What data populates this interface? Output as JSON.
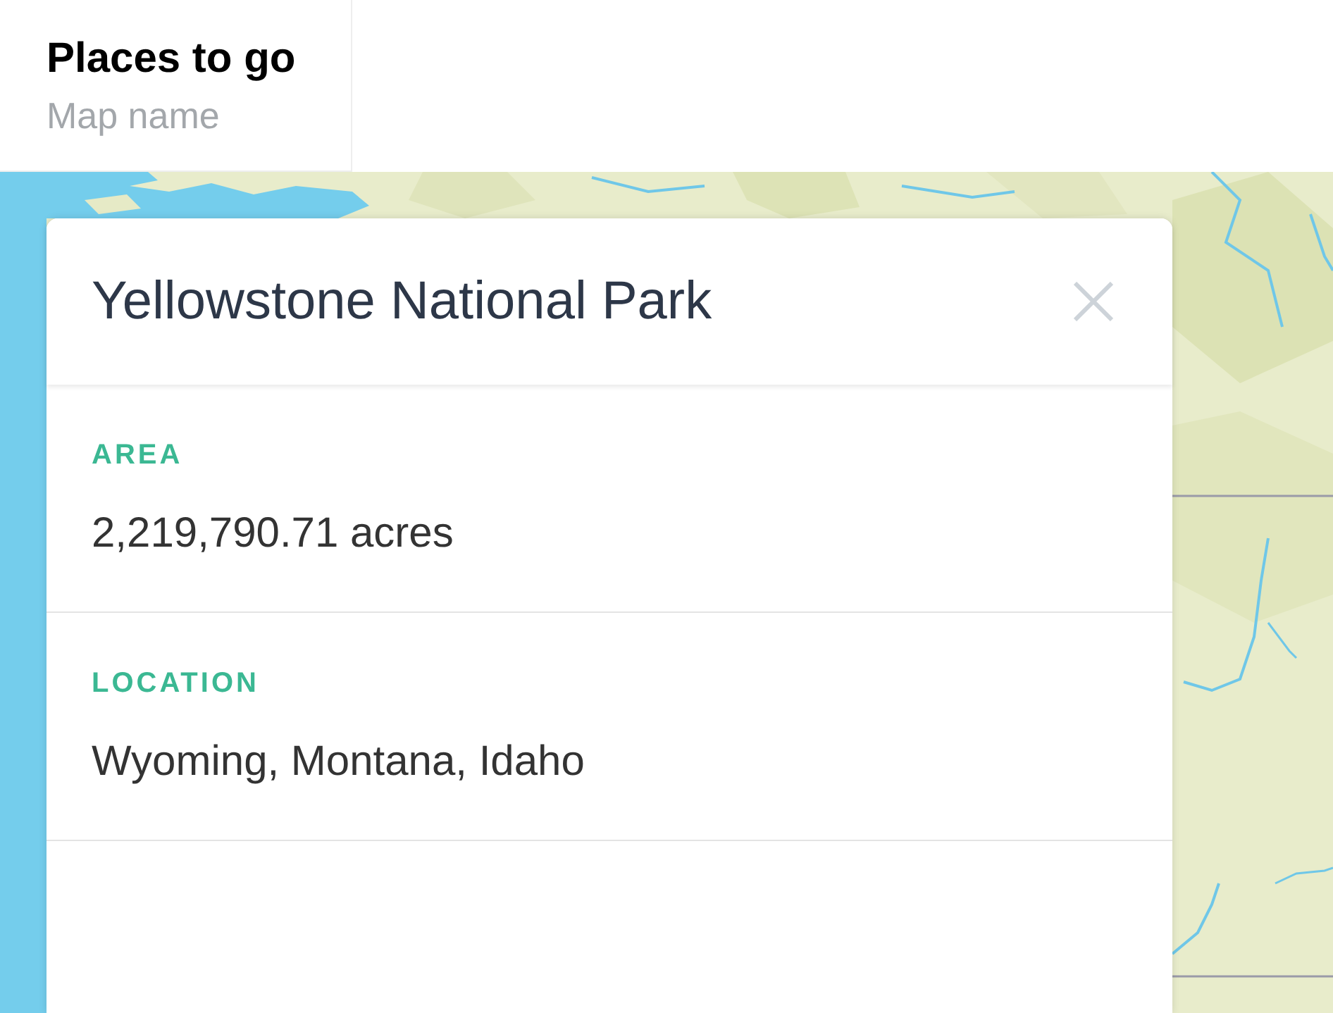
{
  "header": {
    "title": "Places to go",
    "subtitle": "Map name"
  },
  "panel": {
    "title": "Yellowstone National Park",
    "fields": [
      {
        "label": "AREA",
        "value": "2,219,790.71 acres"
      },
      {
        "label": "LOCATION",
        "value": "Wyoming, Montana, Idaho"
      }
    ]
  }
}
